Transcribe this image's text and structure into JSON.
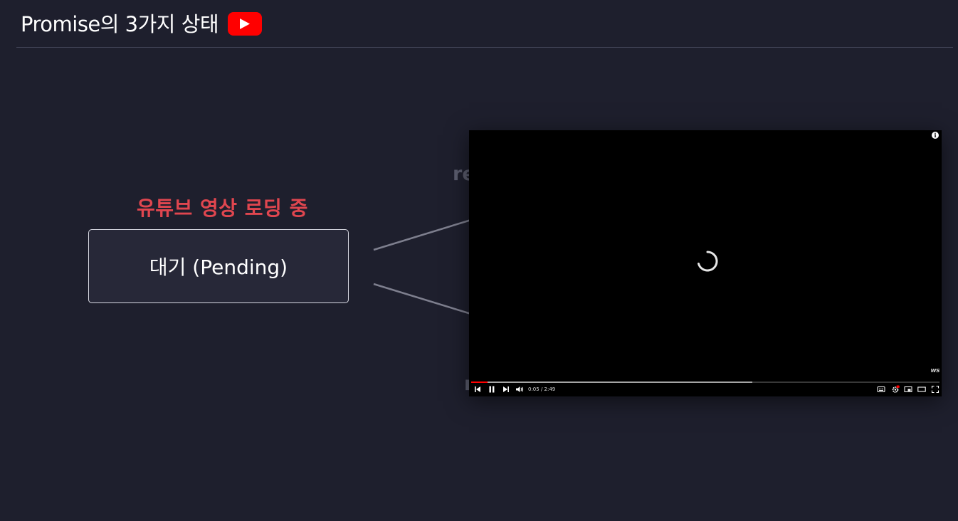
{
  "header": {
    "title": "Promise의 3가지 상태",
    "youtube_icon": "youtube-play-icon"
  },
  "diagram": {
    "loading_label": "유튜브 영상 로딩 중",
    "state_label": "대기 (Pending)",
    "ghost_text_top": "re",
    "ghost_text_bottom": "r"
  },
  "player": {
    "time": "0:05 / 2:49",
    "played_fraction": 0.035,
    "buffered_fraction": 0.6,
    "watermark": "ws",
    "icons": [
      "info-icon",
      "loading-spinner-icon",
      "previous-icon",
      "pause-icon",
      "next-icon",
      "volume-icon",
      "captions-icon",
      "settings-icon",
      "miniplayer-icon",
      "theater-icon",
      "fullscreen-icon"
    ]
  },
  "colors": {
    "background": "#1e1f2d",
    "accent_red": "#e0464f",
    "youtube_red": "#ff0000"
  }
}
